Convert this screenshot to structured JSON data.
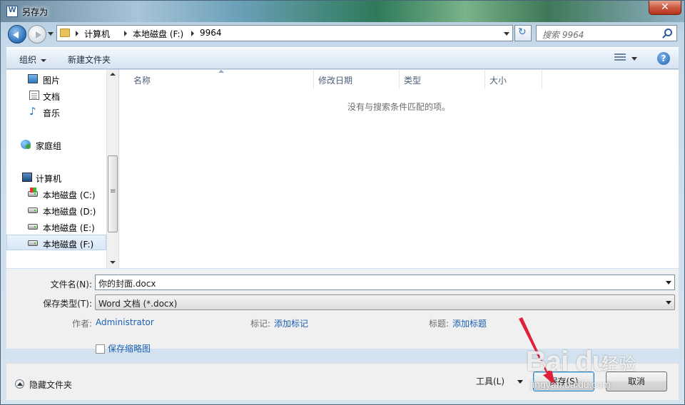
{
  "window": {
    "title": "另存为",
    "close_symbol": "✕"
  },
  "address_bar": {
    "crumbs": [
      "计算机",
      "本地磁盘 (F:)",
      "9964"
    ],
    "refresh_symbol": "↻"
  },
  "search": {
    "placeholder": "搜索 9964"
  },
  "toolbar": {
    "organize_label": "组织",
    "new_folder_label": "新建文件夹",
    "help_symbol": "?"
  },
  "nav": {
    "items": [
      {
        "label": "图片",
        "icon": "pictures-icon"
      },
      {
        "label": "文档",
        "icon": "documents-icon"
      },
      {
        "label": "音乐",
        "icon": "music-icon"
      },
      {
        "label": "家庭组",
        "icon": "homegroup-icon"
      },
      {
        "label": "计算机",
        "icon": "computer-icon"
      },
      {
        "label": "本地磁盘 (C:)",
        "icon": "system-drive-icon"
      },
      {
        "label": "本地磁盘 (D:)",
        "icon": "drive-icon"
      },
      {
        "label": "本地磁盘 (E:)",
        "icon": "drive-icon"
      },
      {
        "label": "本地磁盘 (F:)",
        "icon": "drive-icon",
        "selected": true
      }
    ]
  },
  "filelist": {
    "columns": [
      "名称",
      "修改日期",
      "类型",
      "大小"
    ],
    "empty_message": "没有与搜索条件匹配的项。"
  },
  "form": {
    "filename_label": "文件名(N):",
    "filename_value": "你的封面.docx",
    "filetype_label": "保存类型(T):",
    "filetype_value": "Word 文档 (*.docx)",
    "author_label": "作者:",
    "author_value": "Administrator",
    "tags_label": "标记:",
    "tags_value": "添加标记",
    "title_label": "标题:",
    "title_value": "添加标题",
    "thumbnail_label": "保存缩略图"
  },
  "footer": {
    "hide_folders_label": "隐藏文件夹",
    "tools_label": "工具(L)",
    "save_label": "保存(S)",
    "cancel_label": "取消"
  },
  "watermark": {
    "logo_text": "Bai du",
    "cn_text": "经验",
    "url_text": "jingyan.baidu.com"
  },
  "colors": {
    "link": "#1a5fb4",
    "annotation_arrow": "#e0203a",
    "close_button": "#c95a41"
  }
}
